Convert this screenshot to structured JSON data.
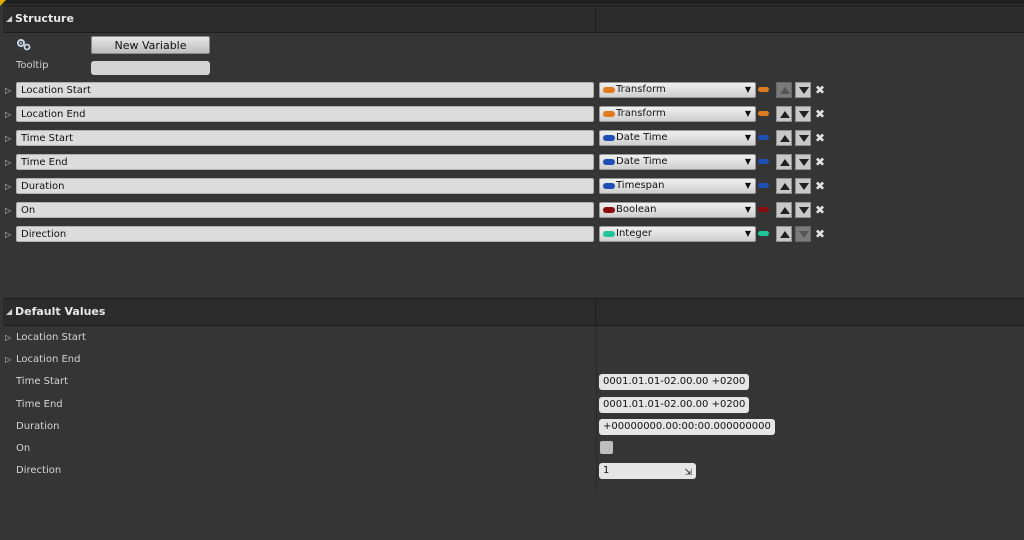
{
  "structure": {
    "title": "Structure",
    "new_variable_label": "New Variable",
    "tooltip_label": "Tooltip",
    "tooltip_value": "",
    "variables": [
      {
        "name": "Location Start",
        "type": "Transform",
        "color": "#e07a1f",
        "up_enabled": false,
        "down_enabled": true
      },
      {
        "name": "Location End",
        "type": "Transform",
        "color": "#e07a1f",
        "up_enabled": true,
        "down_enabled": true
      },
      {
        "name": "Time Start",
        "type": "Date Time",
        "color": "#1f4fb5",
        "up_enabled": true,
        "down_enabled": true
      },
      {
        "name": "Time End",
        "type": "Date Time",
        "color": "#1f4fb5",
        "up_enabled": true,
        "down_enabled": true
      },
      {
        "name": "Duration",
        "type": "Timespan",
        "color": "#1f4fb5",
        "up_enabled": true,
        "down_enabled": true
      },
      {
        "name": "On",
        "type": "Boolean",
        "color": "#8a0c0c",
        "up_enabled": true,
        "down_enabled": true
      },
      {
        "name": "Direction",
        "type": "Integer",
        "color": "#1fc49a",
        "up_enabled": true,
        "down_enabled": false
      }
    ]
  },
  "default_values": {
    "title": "Default Values",
    "rows": [
      {
        "label": "Location Start",
        "expandable": true,
        "kind": "none",
        "value": ""
      },
      {
        "label": "Location End",
        "expandable": true,
        "kind": "none",
        "value": ""
      },
      {
        "label": "Time Start",
        "expandable": false,
        "kind": "text",
        "value": "0001.01.01-02.00.00 +0200"
      },
      {
        "label": "Time End",
        "expandable": false,
        "kind": "text",
        "value": "0001.01.01-02.00.00 +0200"
      },
      {
        "label": "Duration",
        "expandable": false,
        "kind": "text",
        "value": "+00000000.00:00:00.000000000"
      },
      {
        "label": "On",
        "expandable": false,
        "kind": "checkbox",
        "value": "unchecked"
      },
      {
        "label": "Direction",
        "expandable": false,
        "kind": "number",
        "value": "1"
      }
    ]
  },
  "icons": {
    "collapse": "▲",
    "expand": "▷",
    "dropdown": "▼",
    "remove": "✖",
    "spin": "⇲"
  }
}
